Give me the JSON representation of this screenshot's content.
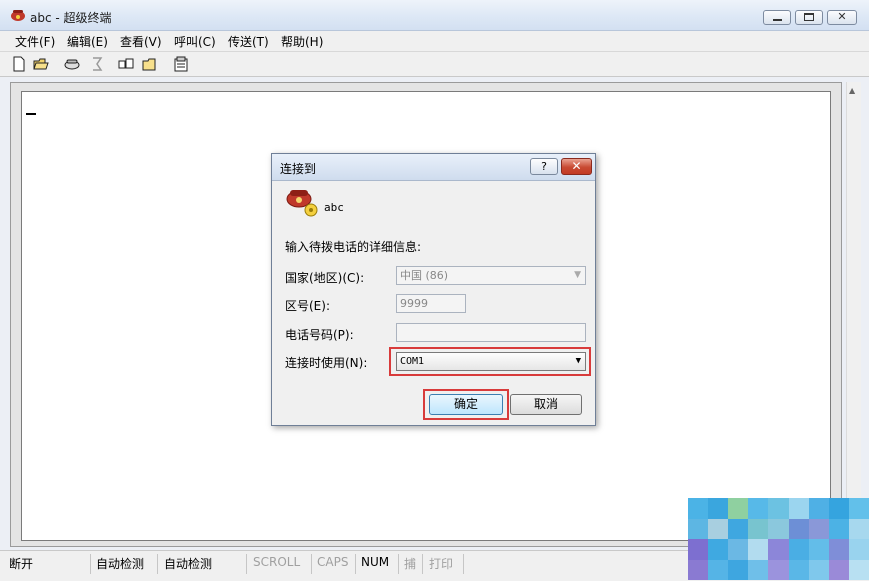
{
  "window": {
    "title": "abc - 超级终端"
  },
  "menu": [
    "文件(F)",
    "编辑(E)",
    "查看(V)",
    "呼叫(C)",
    "传送(T)",
    "帮助(H)"
  ],
  "toolbar_icons": [
    "new-icon",
    "open-icon",
    "call-icon",
    "disconnect-icon",
    "send-icon",
    "receive-icon",
    "properties-icon"
  ],
  "dialog": {
    "title": "连接到",
    "help_label": "?",
    "close_label": "✕",
    "connection_name": "abc",
    "prompt": "输入待拨电话的详细信息:",
    "country_label": "国家(地区)(C):",
    "country_value": "中国 (86)",
    "area_label": "区号(E):",
    "area_value": "9999",
    "phone_label": "电话号码(P):",
    "phone_value": "",
    "connect_label": "连接时使用(N):",
    "connect_value": "COM1",
    "ok_label": "确定",
    "cancel_label": "取消"
  },
  "status": {
    "connection": "断开",
    "detect1": "自动检测",
    "detect2": "自动检测",
    "scroll": "SCROLL",
    "caps": "CAPS",
    "num": "NUM",
    "capture": "捕",
    "print": "打印"
  },
  "colors": {
    "highlight": "#d83b3b",
    "disabled_text": "#a0a0a0"
  }
}
